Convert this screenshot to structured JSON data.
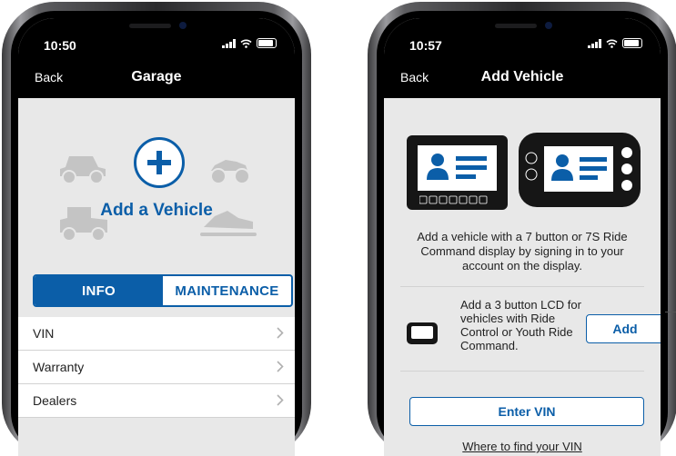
{
  "left_phone": {
    "status_time": "10:50",
    "nav": {
      "back_label": "Back",
      "title": "Garage"
    },
    "hero": {
      "add_vehicle_label": "Add a Vehicle"
    },
    "segment": {
      "tabs": [
        {
          "label": "INFO",
          "active": true
        },
        {
          "label": "MAINTENANCE",
          "active": false
        }
      ]
    },
    "list": [
      {
        "label": "VIN"
      },
      {
        "label": "Warranty"
      },
      {
        "label": "Dealers"
      }
    ]
  },
  "right_phone": {
    "status_time": "10:57",
    "nav": {
      "back_label": "Back",
      "title": "Add Vehicle"
    },
    "description": "Add a vehicle with a 7 button or 7S Ride Command display by signing in to your account on the display.",
    "lcd_text": "Add a 3 button LCD for vehicles with Ride Control or Youth Ride Command.",
    "add_button": "Add",
    "enter_vin_button": "Enter VIN",
    "where_link": "Where to find your VIN"
  },
  "colors": {
    "accent": "#0b5ea8",
    "nav_bg": "#000000",
    "screen_bg": "#e8e8e8",
    "vehicle_silhouette": "#c4c4c4"
  }
}
